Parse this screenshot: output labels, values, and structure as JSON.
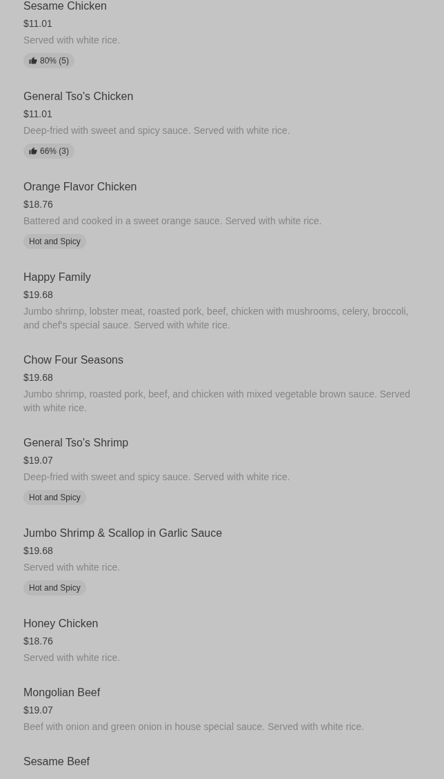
{
  "menu_items": [
    {
      "name": "Sesame Chicken",
      "price": "$11.01",
      "description": "Served with white rice.",
      "tags": [
        {
          "kind": "rating",
          "label": "80% (5)"
        }
      ]
    },
    {
      "name": "General Tso's Chicken",
      "price": "$11.01",
      "description": "Deep-fried with sweet and spicy sauce. Served with white rice.",
      "tags": [
        {
          "kind": "rating",
          "label": "66% (3)"
        }
      ]
    },
    {
      "name": "Orange Flavor Chicken",
      "price": "$18.76",
      "description": "Battered and cooked in a sweet orange sauce. Served with white rice.",
      "tags": [
        {
          "kind": "tag",
          "label": "Hot and Spicy"
        }
      ]
    },
    {
      "name": "Happy Family",
      "price": "$19.68",
      "description": "Jumbo shrimp, lobster meat, roasted pork, beef, chicken with mushrooms, celery, broccoli, and chef's special sauce. Served with white rice."
    },
    {
      "name": "Chow Four Seasons",
      "price": "$19.68",
      "description": "Jumbo shrimp, roasted pork, beef, and chicken with mixed vegetable brown sauce. Served with white rice."
    },
    {
      "name": "General Tso's Shrimp",
      "price": "$19.07",
      "description": "Deep-fried with sweet and spicy sauce. Served with white rice.",
      "tags": [
        {
          "kind": "tag",
          "label": "Hot and Spicy"
        }
      ]
    },
    {
      "name": "Jumbo Shrimp & Scallop in Garlic Sauce",
      "price": "$19.68",
      "description": "Served with white rice.",
      "tags": [
        {
          "kind": "tag",
          "label": "Hot and Spicy"
        }
      ]
    },
    {
      "name": "Honey Chicken",
      "price": "$18.76",
      "description": "Served with white rice."
    },
    {
      "name": "Mongolian Beef",
      "price": "$19.07",
      "description": "Beef with onion and green onion in house special sauce. Served with white rice."
    },
    {
      "name": "Sesame Beef"
    }
  ]
}
